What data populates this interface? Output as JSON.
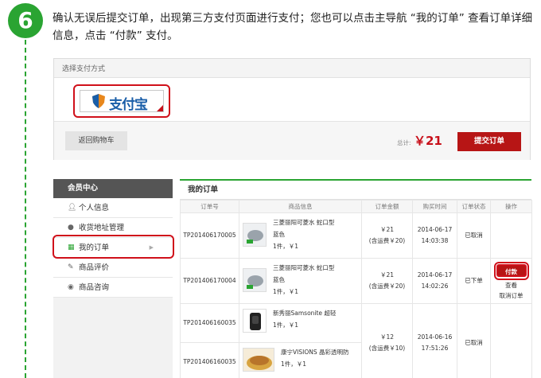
{
  "step": {
    "number": "6",
    "text": "确认无误后提交订单，出现第三方支付页面进行支付；您也可以点击主导航 “我的订单” 查看订单详细信息，点击 “付款” 支付。"
  },
  "payment": {
    "header": "选择支付方式",
    "alipay_logo_text": "支付宝",
    "back_button": "返回购物车",
    "total_label": "总计:",
    "total_value": "￥21",
    "submit_button": "提交订单"
  },
  "sidebar": {
    "title": "会员中心",
    "items": [
      {
        "label": "个人信息",
        "icon": "user-icon"
      },
      {
        "label": "收货地址管理",
        "icon": "map-pin-icon"
      },
      {
        "label": "我的订单",
        "icon": "document-icon"
      },
      {
        "label": "商品评价",
        "icon": "pencil-icon"
      },
      {
        "label": "商品咨询",
        "icon": "chat-bubble-icon"
      }
    ],
    "active_arrow": "▶"
  },
  "orders": {
    "title": "我的订单",
    "columns": [
      "订单号",
      "商品信息",
      "订单金额",
      "购买时间",
      "订单状态",
      "操作"
    ],
    "rows": [
      {
        "id": "TP201406170005",
        "name": "三菱丽阳可菱水 蛇口型",
        "color": "蓝色",
        "qty": "1件，￥1",
        "amount": "￥21",
        "shipping": "(含运费￥20)",
        "date": "2014-06-17",
        "time": "14:03:38",
        "status": "已取消"
      },
      {
        "id": "TP201406170004",
        "name": "三菱丽阳可菱水 蛇口型",
        "color": "蓝色",
        "qty": "1件，￥1",
        "amount": "￥21",
        "shipping": "(含运费￥20)",
        "date": "2014-06-17",
        "time": "14:02:26",
        "status": "已下单",
        "actions": {
          "pay": "付款",
          "view": "查看",
          "cancel": "取消订单"
        }
      },
      {
        "id": "TP201406160035",
        "name": "新秀丽Samsonite 超轻",
        "qty": "1件，￥1"
      },
      {
        "id": "TP201406160035",
        "name": "康宁VISIONS 晶彩透明防",
        "qty": "1件，￥1"
      }
    ],
    "merged": {
      "amount": "￥12",
      "shipping": "(含运费￥10)",
      "date": "2014-06-16",
      "time": "17:51:26",
      "status": "已取消"
    }
  },
  "colors": {
    "accent_green": "#2aa432",
    "brand_red": "#b71515",
    "highlight_red": "#d0101a"
  }
}
